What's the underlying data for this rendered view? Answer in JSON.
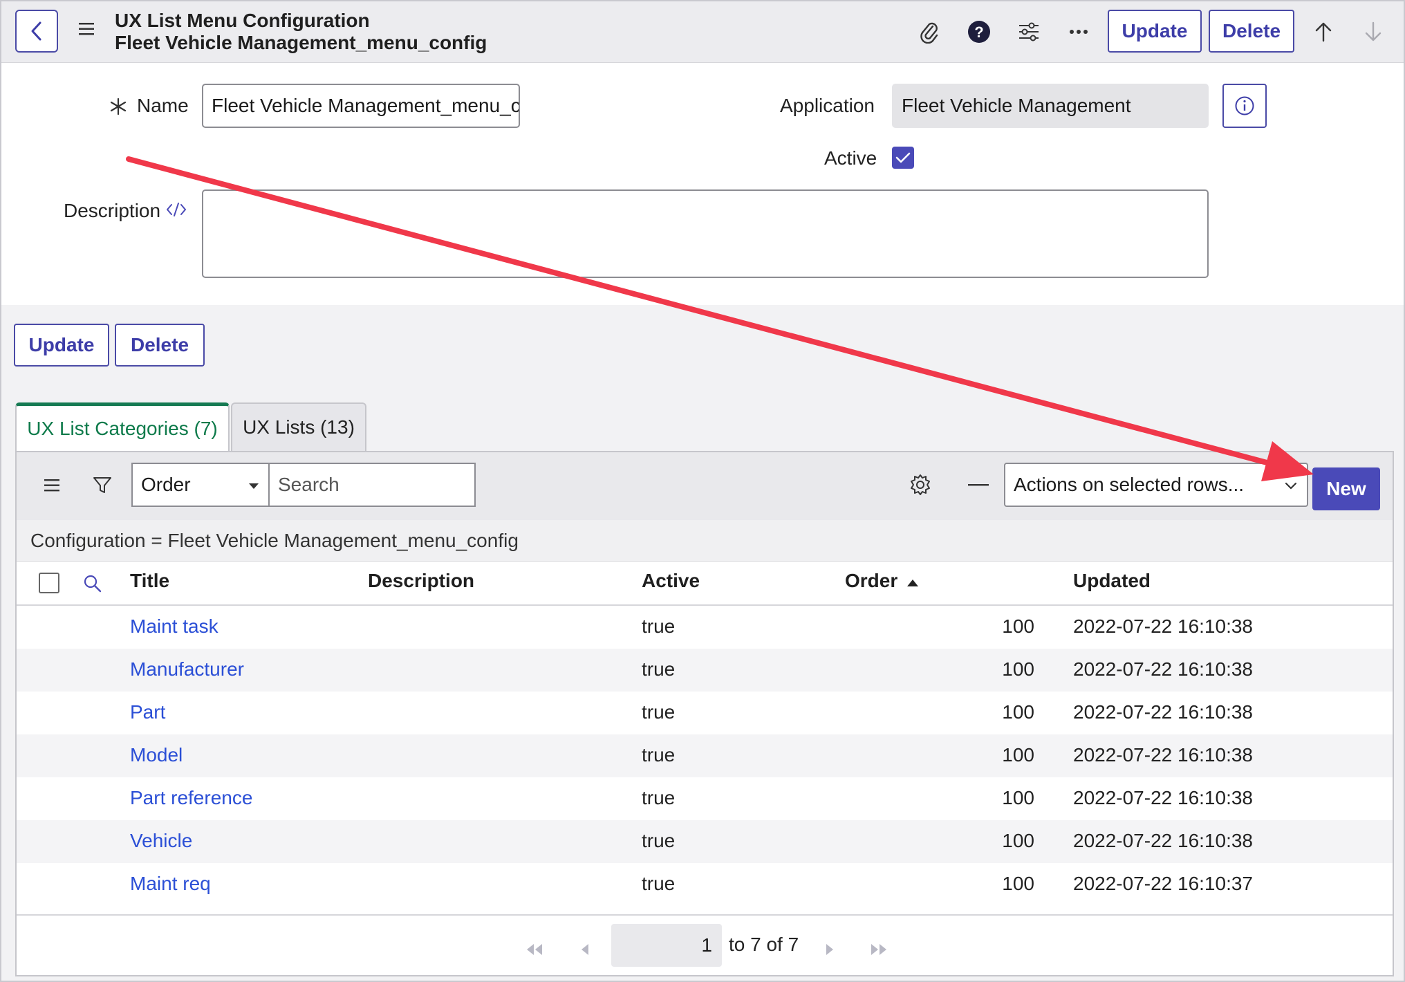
{
  "header": {
    "title_line1": "UX List Menu Configuration",
    "title_line2": "Fleet Vehicle Management_menu_config",
    "update_label": "Update",
    "delete_label": "Delete"
  },
  "form": {
    "name_label": "Name",
    "name_value": "Fleet Vehicle Management_menu_config",
    "application_label": "Application",
    "application_value": "Fleet Vehicle Management",
    "active_label": "Active",
    "active_checked": true,
    "description_label": "Description",
    "description_value": ""
  },
  "form_actions": {
    "update_label": "Update",
    "delete_label": "Delete"
  },
  "tabs": [
    {
      "label": "UX List Categories (7)",
      "active": true
    },
    {
      "label": "UX Lists (13)",
      "active": false
    }
  ],
  "list": {
    "sort_field": "Order",
    "search_placeholder": "Search",
    "actions_label": "Actions on selected rows...",
    "new_label": "New",
    "filter_breadcrumb": "Configuration = Fleet Vehicle Management_menu_config",
    "columns": [
      "Title",
      "Description",
      "Active",
      "Order",
      "Updated"
    ],
    "sorted_column": "Order",
    "rows": [
      {
        "title": "Maint task",
        "description": "",
        "active": "true",
        "order": "100",
        "updated": "2022-07-22 16:10:38"
      },
      {
        "title": "Manufacturer",
        "description": "",
        "active": "true",
        "order": "100",
        "updated": "2022-07-22 16:10:38"
      },
      {
        "title": "Part",
        "description": "",
        "active": "true",
        "order": "100",
        "updated": "2022-07-22 16:10:38"
      },
      {
        "title": "Model",
        "description": "",
        "active": "true",
        "order": "100",
        "updated": "2022-07-22 16:10:38"
      },
      {
        "title": "Part reference",
        "description": "",
        "active": "true",
        "order": "100",
        "updated": "2022-07-22 16:10:38"
      },
      {
        "title": "Vehicle",
        "description": "",
        "active": "true",
        "order": "100",
        "updated": "2022-07-22 16:10:38"
      },
      {
        "title": "Maint req",
        "description": "",
        "active": "true",
        "order": "100",
        "updated": "2022-07-22 16:10:37"
      }
    ],
    "pagination": {
      "current_page": "1",
      "range_text": "to 7 of 7"
    }
  },
  "colors": {
    "accent": "#4a4ab8",
    "link": "#2b4fd6",
    "active_tab": "#0d7a4a",
    "annotation_arrow": "#f0384a"
  }
}
